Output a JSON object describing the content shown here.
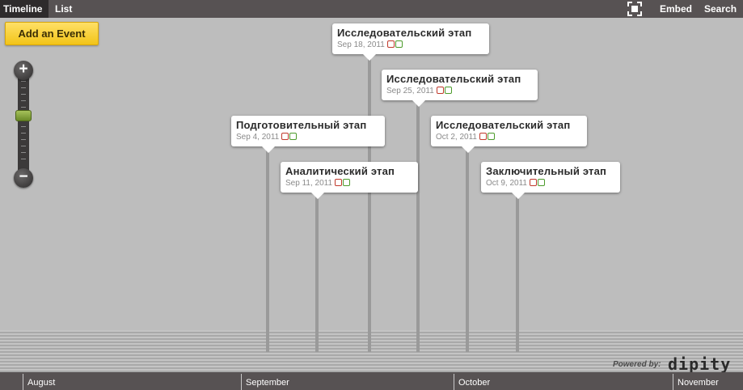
{
  "topbar": {
    "tabs": [
      {
        "label": "Timeline",
        "active": true
      },
      {
        "label": "List",
        "active": false
      }
    ],
    "embed_label": "Embed",
    "search_label": "Search",
    "fullscreen_icon": "fullscreen-icon"
  },
  "toolbar": {
    "add_event_label": "Add an Event",
    "zoom_in_label": "+",
    "zoom_out_label": "−"
  },
  "events": [
    {
      "title": "Исследовательский этап",
      "date": "Sep 18, 2011"
    },
    {
      "title": "Исследовательский этап",
      "date": "Sep 25, 2011"
    },
    {
      "title": "Подготовительный этап",
      "date": "Sep 4, 2011"
    },
    {
      "title": "Исследовательский этап",
      "date": "Oct 2, 2011"
    },
    {
      "title": "Аналитический этап",
      "date": "Sep 11, 2011"
    },
    {
      "title": "Заключительный этап",
      "date": "Oct 9, 2011"
    }
  ],
  "footer": {
    "powered_by": "Powered by:",
    "brand": "dipity"
  },
  "axis": {
    "months": [
      "August",
      "September",
      "October",
      "November"
    ]
  },
  "colors": {
    "topbar": "#575253",
    "canvas": "#bdbdbd",
    "add_button": "#f2c418",
    "zoom_handle": "#8aa63a"
  }
}
